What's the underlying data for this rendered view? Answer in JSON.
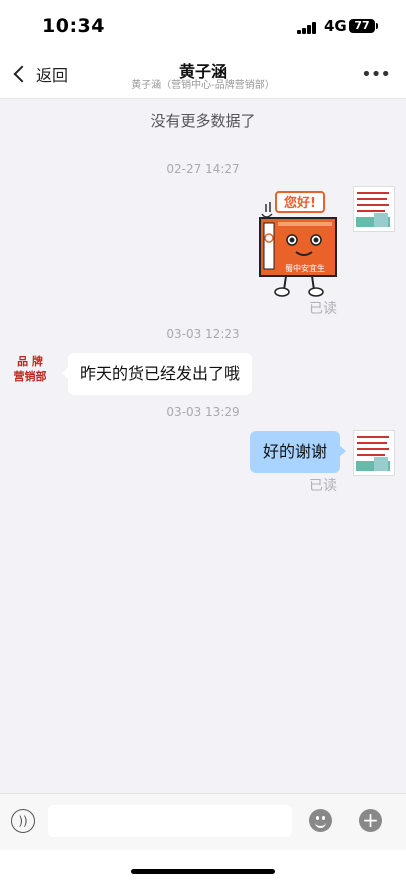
{
  "status": {
    "time": "10:34",
    "network": "4G",
    "battery": "77"
  },
  "nav": {
    "back_label": "返回",
    "title": "黄子涵",
    "subtitle": "黄子涵（营销中心-品牌营销部）",
    "more_icon": "more-dots-icon"
  },
  "chat": {
    "no_more": "没有更多数据了",
    "messages": [
      {
        "timestamp": "02-27 14:27",
        "side": "right",
        "type": "sticker",
        "sticker_text": "您好!",
        "sticker_badge": "蜀中安宜生",
        "read": "已读"
      },
      {
        "timestamp": "03-03 12:23",
        "side": "left",
        "type": "text",
        "text": "昨天的货已经发出了哦",
        "avatar_text": [
          "品 牌",
          "营销部"
        ]
      },
      {
        "timestamp": "03-03 13:29",
        "side": "right",
        "type": "text",
        "text": "好的谢谢",
        "read": "已读"
      }
    ]
  },
  "input": {
    "value": "",
    "voice_icon": "voice-icon",
    "emoji_icon": "emoji-icon",
    "plus_icon": "plus-icon"
  },
  "colors": {
    "outgoing_bubble": "#a9d4ff",
    "background": "#f2f2f7",
    "sticker_orange": "#e8622a"
  }
}
